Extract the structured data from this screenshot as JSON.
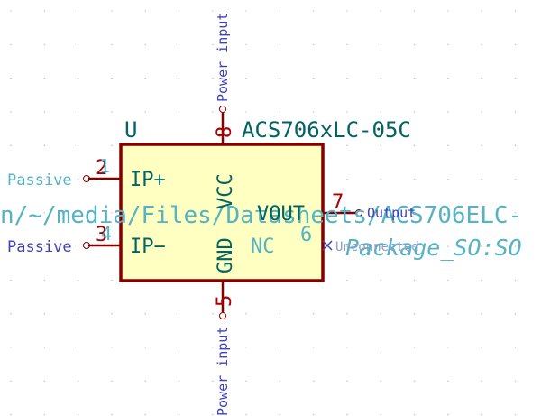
{
  "component": {
    "reference": "U",
    "value": "ACS706xLC-05C",
    "datasheet": "n/~/media/Files/Datasheets/ACS706ELC-",
    "footprint": "Package_SO:SO"
  },
  "pins": {
    "vcc": {
      "number": "8",
      "name": "VCC",
      "type": "Power input"
    },
    "gnd": {
      "number": "5",
      "name": "GND",
      "type": "Power input"
    },
    "ip_plus": {
      "number": "2",
      "name": "IP+",
      "type": "Passive"
    },
    "ip_plus_hidden_num": "1",
    "ip_minus": {
      "number": "3",
      "name": "IP−",
      "type": "Passive"
    },
    "ip_minus_hidden_num": "4",
    "vout": {
      "number": "7",
      "name": "VOUT",
      "type": "Output"
    },
    "nc": {
      "number": "6",
      "name": "NC",
      "type": "Unconnected"
    }
  },
  "colors": {
    "body_fill": "#ffffc2",
    "body_stroke": "#840000",
    "text_teal": "#006464",
    "pin_number": "#a90000",
    "electrical_type": "#4040c0"
  }
}
